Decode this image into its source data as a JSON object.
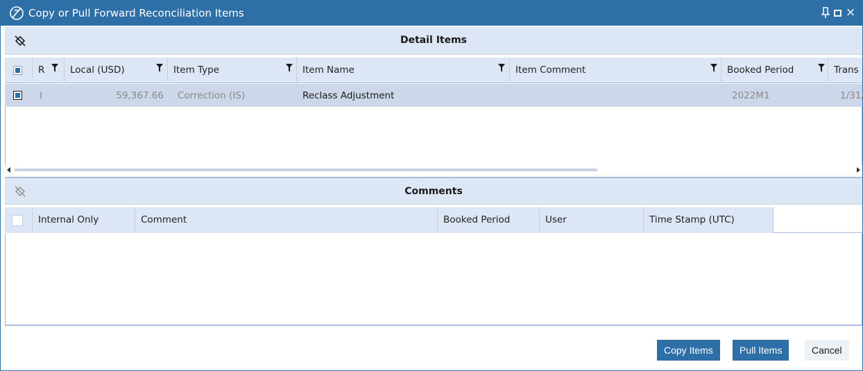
{
  "window": {
    "title": "Copy or Pull Forward Reconciliation Items",
    "logo_icon": "onestream-logo-icon",
    "controls": [
      "pin-icon",
      "maximize-icon",
      "close-icon"
    ],
    "close_glyph": "×"
  },
  "detail_items": {
    "section_title": "Detail Items",
    "columns": {
      "r": "R",
      "local": "Local (USD)",
      "item_type": "Item Type",
      "item_name": "Item Name",
      "item_comment": "Item Comment",
      "booked_period": "Booked Period",
      "trans": "Trans"
    },
    "rows": [
      {
        "r": "I",
        "local": "59,367.66",
        "item_type": "Correction (IS)",
        "item_name": "Reclass Adjustment",
        "item_comment": "",
        "booked_period": "2022M1",
        "trans": "1/31/"
      }
    ]
  },
  "comments": {
    "section_title": "Comments",
    "columns": {
      "internal_only": "Internal Only",
      "comment": "Comment",
      "booked_period": "Booked Period",
      "user": "User",
      "timestamp": "Time Stamp (UTC)"
    }
  },
  "footer": {
    "copy_label": "Copy Items",
    "pull_label": "Pull Items",
    "cancel_label": "Cancel"
  },
  "colors": {
    "accent": "#2f6fa8",
    "header_bg": "#dde6f5",
    "selected_row": "#ccd7ea"
  }
}
